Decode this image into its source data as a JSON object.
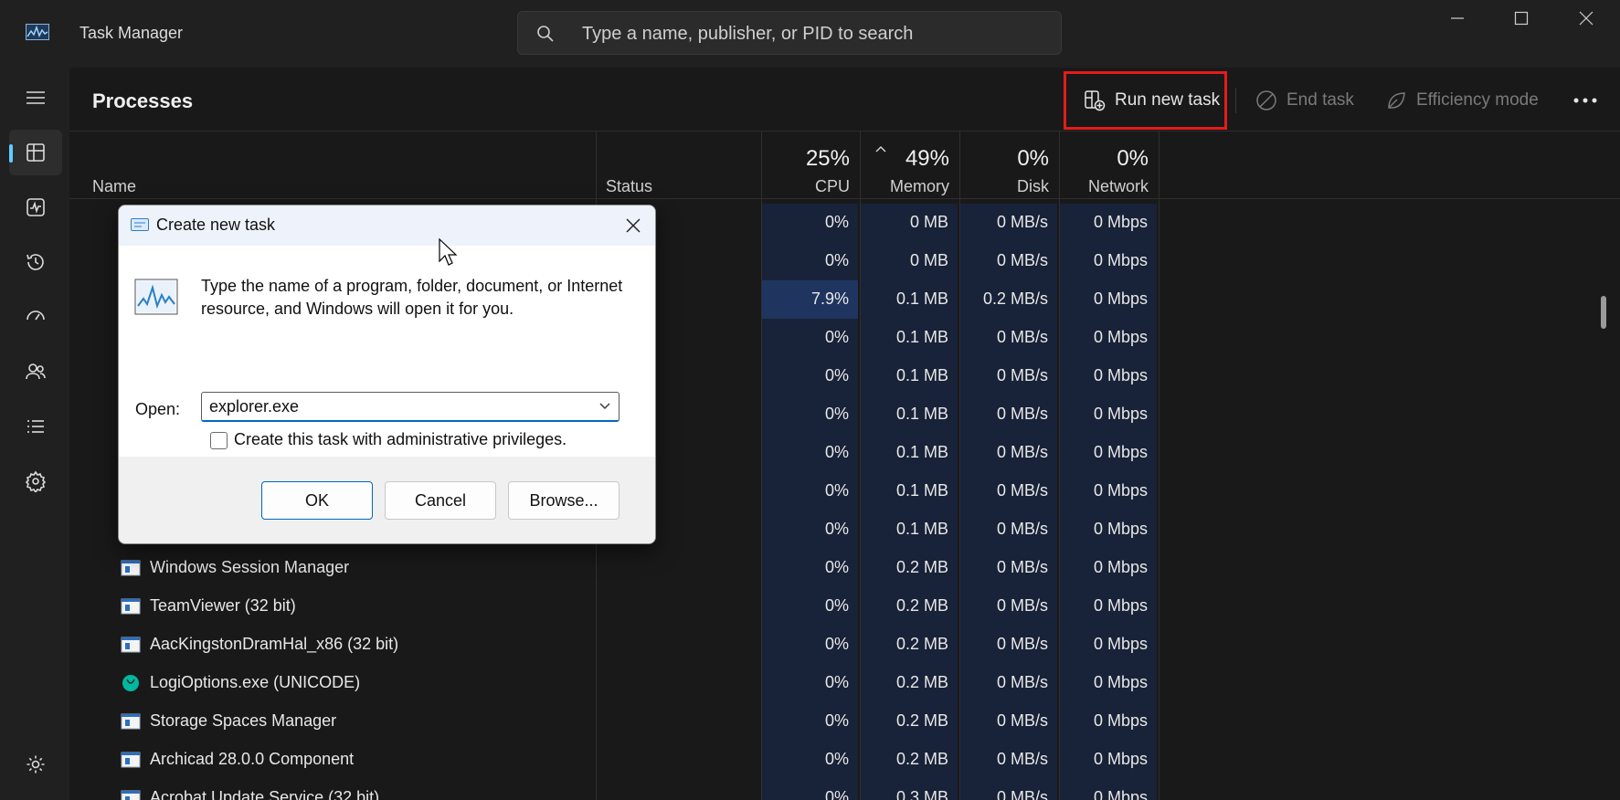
{
  "window": {
    "title": "Task Manager",
    "search_placeholder": "Type a name, publisher, or PID to search"
  },
  "nav": {
    "items": [
      "menu-icon",
      "processes-icon",
      "performance-icon",
      "app-history-icon",
      "startup-apps-icon",
      "users-icon",
      "details-icon",
      "services-icon",
      "settings-icon"
    ],
    "active": "processes",
    "accent": "#60cdff"
  },
  "toolbar": {
    "title": "Processes",
    "run_new_task": "Run new task",
    "end_task": "End task",
    "efficiency_mode": "Efficiency mode",
    "highlight_color": "#e41b1b"
  },
  "columns": {
    "name": "Name",
    "status": "Status",
    "cpu": {
      "pct": "25%",
      "label": "CPU"
    },
    "memory": {
      "pct": "49%",
      "label": "Memory"
    },
    "disk": {
      "pct": "0%",
      "label": "Disk"
    },
    "network": {
      "pct": "0%",
      "label": "Network"
    }
  },
  "rows": [
    {
      "name": "",
      "cpu": "0%",
      "memory": "0 MB",
      "disk": "0 MB/s",
      "network": "0 Mbps"
    },
    {
      "name": "",
      "cpu": "0%",
      "memory": "0 MB",
      "disk": "0 MB/s",
      "network": "0 Mbps"
    },
    {
      "name": "",
      "cpu": "7.9%",
      "memory": "0.1 MB",
      "disk": "0.2 MB/s",
      "network": "0 Mbps"
    },
    {
      "name": "",
      "cpu": "0%",
      "memory": "0.1 MB",
      "disk": "0 MB/s",
      "network": "0 Mbps"
    },
    {
      "name": "",
      "cpu": "0%",
      "memory": "0.1 MB",
      "disk": "0 MB/s",
      "network": "0 Mbps"
    },
    {
      "name": "",
      "cpu": "0%",
      "memory": "0.1 MB",
      "disk": "0 MB/s",
      "network": "0 Mbps"
    },
    {
      "name": "",
      "cpu": "0%",
      "memory": "0.1 MB",
      "disk": "0 MB/s",
      "network": "0 Mbps"
    },
    {
      "name": "",
      "cpu": "0%",
      "memory": "0.1 MB",
      "disk": "0 MB/s",
      "network": "0 Mbps"
    },
    {
      "name": "",
      "cpu": "0%",
      "memory": "0.1 MB",
      "disk": "0 MB/s",
      "network": "0 Mbps"
    },
    {
      "name": "Windows Session Manager",
      "cpu": "0%",
      "memory": "0.2 MB",
      "disk": "0 MB/s",
      "network": "0 Mbps"
    },
    {
      "name": "TeamViewer (32 bit)",
      "cpu": "0%",
      "memory": "0.2 MB",
      "disk": "0 MB/s",
      "network": "0 Mbps"
    },
    {
      "name": "AacKingstonDramHal_x86 (32 bit)",
      "cpu": "0%",
      "memory": "0.2 MB",
      "disk": "0 MB/s",
      "network": "0 Mbps"
    },
    {
      "name": "LogiOptions.exe (UNICODE)",
      "cpu": "0%",
      "memory": "0.2 MB",
      "disk": "0 MB/s",
      "network": "0 Mbps"
    },
    {
      "name": "Storage Spaces Manager",
      "cpu": "0%",
      "memory": "0.2 MB",
      "disk": "0 MB/s",
      "network": "0 Mbps"
    },
    {
      "name": "Archicad 28.0.0 Component",
      "cpu": "0%",
      "memory": "0.2 MB",
      "disk": "0 MB/s",
      "network": "0 Mbps"
    },
    {
      "name": "Acrobat Update Service (32 bit)",
      "cpu": "0%",
      "memory": "0.3 MB",
      "disk": "0 MB/s",
      "network": "0 Mbps"
    }
  ],
  "dialog": {
    "title": "Create new task",
    "description": "Type the name of a program, folder, document, or Internet resource, and Windows will open it for you.",
    "open_label": "Open:",
    "open_value": "explorer.exe",
    "admin_checkbox_label": "Create this task with administrative privileges.",
    "admin_checked": false,
    "ok": "OK",
    "cancel": "Cancel",
    "browse": "Browse..."
  }
}
